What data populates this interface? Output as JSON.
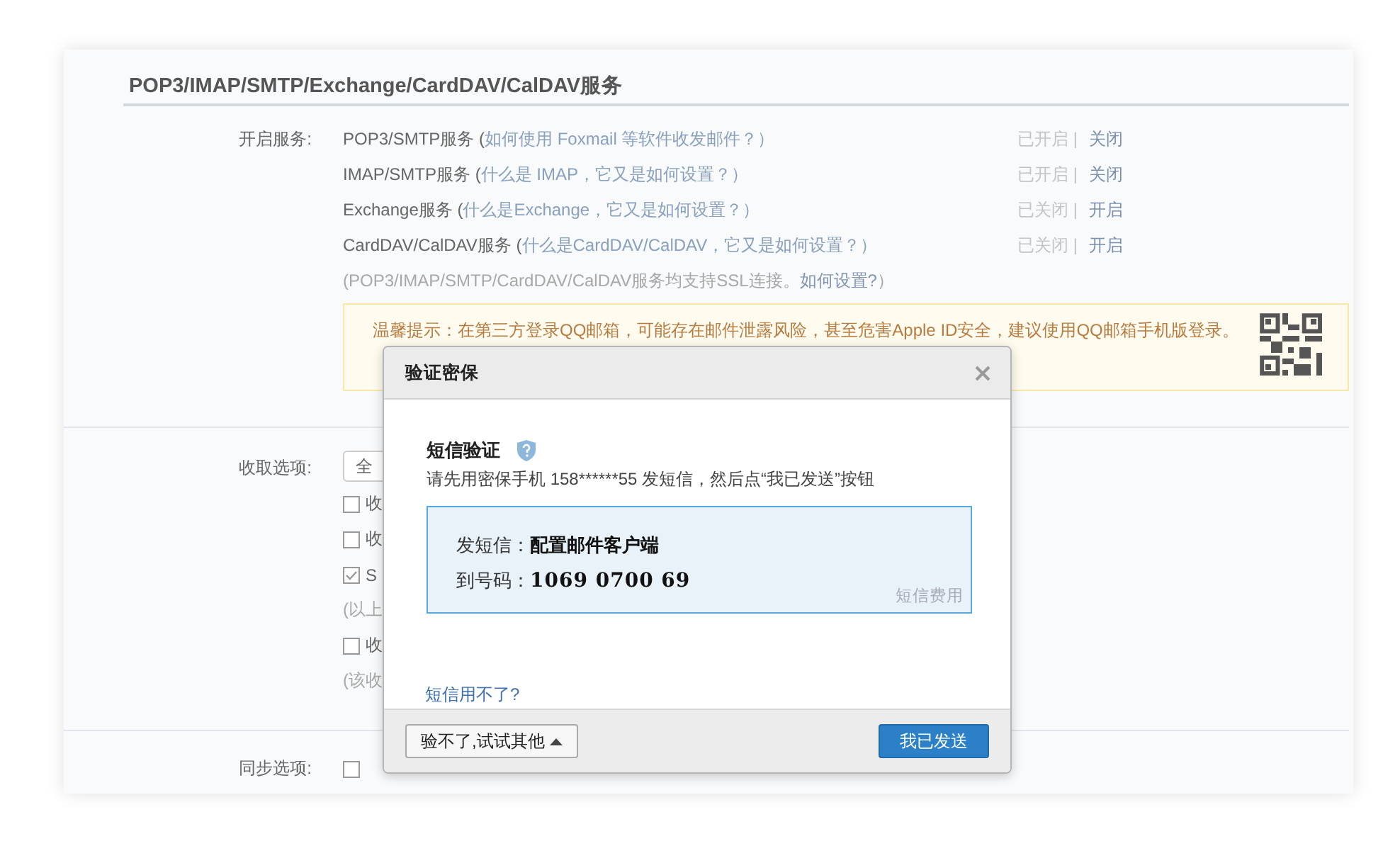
{
  "section_title": "POP3/IMAP/SMTP/Exchange/CardDAV/CalDAV服务",
  "services_label": "开启服务:",
  "services": [
    {
      "name": "POP3/SMTP服务 (",
      "help": "如何使用 Foxmail 等软件收发邮件？）",
      "status": "已开启 |",
      "action": "关闭"
    },
    {
      "name": "IMAP/SMTP服务 (",
      "help": "什么是 IMAP，它又是如何设置？）",
      "status": "已开启 |",
      "action": "关闭"
    },
    {
      "name": "Exchange服务 (",
      "help": "什么是Exchange，它又是如何设置？）",
      "status": "已关闭 |",
      "action": "开启"
    },
    {
      "name": "CardDAV/CalDAV服务 (",
      "help": "什么是CardDAV/CalDAV，它又是如何设置？）",
      "status": "已关闭 |",
      "action": "开启"
    }
  ],
  "ssl_note": {
    "text": "(POP3/IMAP/SMTP/CardDAV/CalDAV服务均支持SSL连接。",
    "link": "如何设置?",
    "close": "）"
  },
  "tip": "温馨提示：在第三方登录QQ邮箱，可能存在邮件泄露风险，甚至危害Apple ID安全，建议使用QQ邮箱手机版登录。",
  "receive": {
    "label": "收取选项:",
    "select_value": "全",
    "rows": [
      {
        "kind": "checkbox",
        "text": "收",
        "checked": false
      },
      {
        "kind": "checkbox",
        "text": "收",
        "checked": false
      },
      {
        "kind": "checkbox",
        "text": "S",
        "checked": true
      },
      {
        "kind": "note",
        "text": "(以上"
      },
      {
        "kind": "checkbox",
        "text": "收",
        "checked": false
      },
      {
        "kind": "note",
        "text": "(该收"
      }
    ]
  },
  "sync": {
    "label": "同步选项:",
    "checked": false
  },
  "dialog": {
    "title": "验证密保",
    "heading": "短信验证",
    "instruction": "请先用密保手机 158******55 发短信，然后点“我已发送”按钮",
    "sms": [
      {
        "label": "发短信：",
        "value": "配置邮件客户端",
        "kind": "text"
      },
      {
        "label": "到号码：",
        "value": "1069 0700 69",
        "kind": "number"
      }
    ],
    "fee_link": "短信费用",
    "help_link": "短信用不了?",
    "other_button": "验不了,试试其他",
    "confirm_button": "我已发送"
  }
}
